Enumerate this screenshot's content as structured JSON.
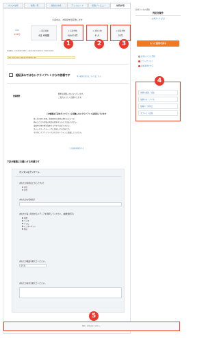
{
  "tabs": [
    {
      "label": "ネスタ市場"
    },
    {
      "label": "依頼一覧"
    },
    {
      "label": "提案の作成"
    },
    {
      "label": "アップロード"
    },
    {
      "label": "投稿プレビュー"
    },
    {
      "label": "依頼詳細",
      "active": true
    }
  ],
  "header": {
    "deadline": "今週中は、お時間を限定致します"
  },
  "stats": {
    "price_label": "¥30",
    "price_value": "¥45円",
    "budget_label": "① 固定報酬",
    "budget_value": "4日 6時間",
    "item1_label": "③ 応募件数",
    "item1_value": "0/400 件",
    "item2_label": "④ 契約人数",
    "item2_value": "6 人",
    "item3_label": "⑤ 募集件数",
    "item3_value": "0 件"
  },
  "badges": {
    "b1": "1",
    "b2": "2",
    "b3": "3",
    "b4": "4",
    "b5": "5"
  },
  "meta": {
    "line": "依頼番号: 1234567   掲載日: 2021/01/01   更新日: 2021/01/04"
  },
  "tagline": "更新  2021/01/21  編集者  PTHNKHU 更新",
  "notice": {
    "title": "認証済みではないクライアントからの依頼です",
    "link": "本人確認の流れについてはこちら"
  },
  "section": {
    "label": "依頼概要",
    "text1": "簡単な問題入力になっています。",
    "text2": "ご協力よろしくお願いします。"
  },
  "conditions": {
    "title": "この依頼は下記のガイドラインに抵触しないクライアントは利用しています",
    "items": [
      "第三者の個人情報、秘密情報の保護に関わるものです。",
      "偽の口コミや評価の捏造を要求するものではありません。",
      "成果物の著作権を侵害する内容ではありません。",
      "ステルスマーケティングに該当しない内容です。",
      "その他、クラウドワークスのガイドラインに抵触していません。"
    ],
    "link_word": "ガイドライン",
    "more_link": "この依頼を報告する"
  },
  "form_section": {
    "heading": "下記が業務にお願いする作業です",
    "form_title": "カンタンなアンケート",
    "q1": "あなたの性別はどちらですか？",
    "q1_opts": [
      "男性",
      "女性"
    ],
    "q2": "あなたのお名前は？",
    "q3": "あなたが良く利用するメディアを選択してください。(複数選択可)",
    "q3_opts": [
      "新聞",
      "ラジオ",
      "テレビ",
      "インターネット",
      "雑誌"
    ],
    "q4": "あなたの職業を教えてください。",
    "q4_select": "会社員",
    "q5": "あなたの意見を教えてください。"
  },
  "qa": {
    "heading": "質問・回答一覧",
    "sub": "（質問は一部公開されています）",
    "empty": "質問・回答はありません。"
  },
  "sidebar": {
    "t1": "仕事ランクの評価",
    "t2": "判定対象外",
    "link": "仕事ランクとは？",
    "button": "もっと回答を見る",
    "items": [
      {
        "label": "お気に入りに登録",
        "color": "#9e9e9e"
      },
      {
        "label": "ブラックリスト",
        "color": "#e8392a"
      },
      {
        "label": "違反報告をする",
        "color": "#e8392a"
      }
    ],
    "menu": [
      "依頼の編集・追加",
      "依頼のオープン化",
      "依頼の一時停止",
      "オプション追加"
    ]
  }
}
